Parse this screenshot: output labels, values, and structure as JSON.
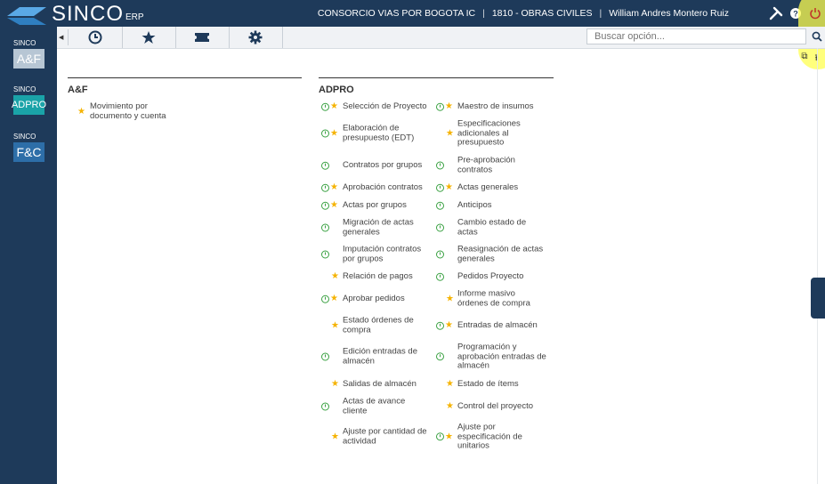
{
  "header": {
    "brand": "SINCO",
    "brand_suffix": "ERP",
    "company": "CONSORCIO VIAS POR BOGOTA IC",
    "project": "1810 - OBRAS CIVILES",
    "user": "William Andres Montero Ruiz",
    "icons": [
      "tools-icon",
      "help-cloud-icon",
      "power-icon"
    ]
  },
  "sidebar": {
    "modules": [
      {
        "label": "SINCO",
        "name": "A&F",
        "color": "#b7c6d4"
      },
      {
        "label": "SINCO",
        "name": "ADPRO",
        "color": "#1aa3a8"
      },
      {
        "label": "SINCO",
        "name": "F&C",
        "color": "#2d6ea8"
      }
    ]
  },
  "toolbar": {
    "icons": [
      "clock-icon",
      "star-icon",
      "ticket-icon",
      "gear-icon"
    ],
    "search_placeholder": "Buscar opción..."
  },
  "sections": {
    "af": {
      "title": "A&F",
      "items": [
        {
          "text": "Movimiento por documento y cuenta",
          "clock": false,
          "star": true
        }
      ]
    },
    "adpro": {
      "title": "ADPRO",
      "left": [
        {
          "text": "Selección de Proyecto",
          "clock": true,
          "star": true
        },
        {
          "text": "Elaboración de presupuesto (EDT)",
          "clock": true,
          "star": true
        },
        {
          "text": "Contratos por grupos",
          "clock": true,
          "star": false
        },
        {
          "text": "Aprobación contratos",
          "clock": true,
          "star": true
        },
        {
          "text": "Actas por grupos",
          "clock": true,
          "star": true
        },
        {
          "text": "Migración de actas generales",
          "clock": true,
          "star": false
        },
        {
          "text": "Imputación contratos por grupos",
          "clock": true,
          "star": false
        },
        {
          "text": "Relación de pagos",
          "clock": false,
          "star": true
        },
        {
          "text": "Aprobar pedidos",
          "clock": true,
          "star": true
        },
        {
          "text": "Estado órdenes de compra",
          "clock": false,
          "star": true
        },
        {
          "text": "Edición entradas de almacén",
          "clock": true,
          "star": false
        },
        {
          "text": "Salidas de almacén",
          "clock": false,
          "star": true
        },
        {
          "text": "Actas de avance cliente",
          "clock": true,
          "star": false
        },
        {
          "text": "Ajuste por cantidad de actividad",
          "clock": false,
          "star": true
        }
      ],
      "right": [
        {
          "text": "Maestro de insumos",
          "clock": true,
          "star": true
        },
        {
          "text": "Especificaciones adicionales al presupuesto",
          "clock": false,
          "star": true
        },
        {
          "text": "Pre-aprobación contratos",
          "clock": true,
          "star": false
        },
        {
          "text": "Actas generales",
          "clock": true,
          "star": true
        },
        {
          "text": "Anticipos",
          "clock": true,
          "star": false
        },
        {
          "text": "Cambio estado de actas",
          "clock": true,
          "star": false
        },
        {
          "text": "Reasignación de actas generales",
          "clock": true,
          "star": false
        },
        {
          "text": "Pedidos Proyecto",
          "clock": true,
          "star": false
        },
        {
          "text": "Informe masivo órdenes de compra",
          "clock": false,
          "star": true
        },
        {
          "text": "Entradas de almacén",
          "clock": true,
          "star": true
        },
        {
          "text": "Programación y aprobación entradas de almacén",
          "clock": true,
          "star": false
        },
        {
          "text": "Estado de ítems",
          "clock": false,
          "star": true
        },
        {
          "text": "Control del proyecto",
          "clock": false,
          "star": true
        },
        {
          "text": "Ajuste por especificación de unitarios",
          "clock": true,
          "star": true
        }
      ]
    }
  }
}
